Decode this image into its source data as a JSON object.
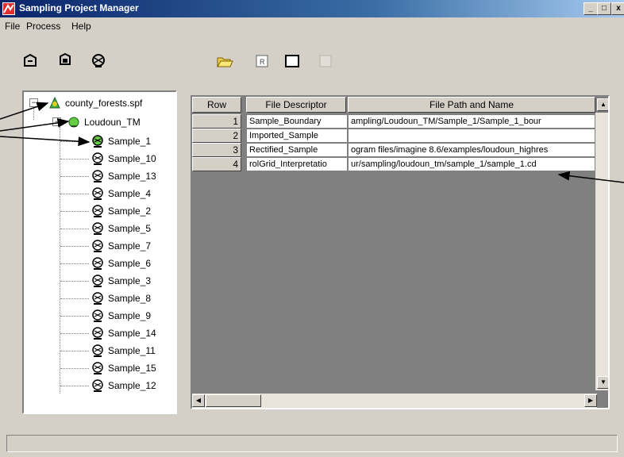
{
  "window": {
    "title": "Sampling Project Manager",
    "controls": {
      "minimize": "_",
      "maximize": "□",
      "close": "x"
    }
  },
  "menubar": {
    "items": [
      {
        "label": "File"
      },
      {
        "label": "Process"
      },
      {
        "label": "Help"
      }
    ]
  },
  "toolbar": {
    "left_tools": [
      "new-project-icon",
      "open-project-icon",
      "sample-tool-icon"
    ],
    "right_tools": [
      "open-folder-icon",
      "raster-icon",
      "window-icon",
      "disabled-window-icon"
    ]
  },
  "tree": {
    "root": "county_forests.spf",
    "project": "Loudoun_TM",
    "samples": [
      "Sample_1",
      "Sample_10",
      "Sample_13",
      "Sample_4",
      "Sample_2",
      "Sample_5",
      "Sample_7",
      "Sample_6",
      "Sample_3",
      "Sample_8",
      "Sample_9",
      "Sample_14",
      "Sample_11",
      "Sample_15",
      "Sample_12"
    ],
    "root_expander": "−",
    "project_expander": "−"
  },
  "grid": {
    "headers": {
      "row": "Row",
      "descriptor": "File Descriptor",
      "path": "File Path and Name"
    },
    "rows": [
      {
        "row": "1",
        "descriptor": "Sample_Boundary",
        "path": "ampling/Loudoun_TM/Sample_1/Sample_1_bour"
      },
      {
        "row": "2",
        "descriptor": "Imported_Sample",
        "path": ""
      },
      {
        "row": "3",
        "descriptor": "Rectified_Sample",
        "path": "ogram files/imagine 8.6/examples/loudoun_highres"
      },
      {
        "row": "4",
        "descriptor": "rolGrid_Interpretatio",
        "path": "ur/sampling/loudoun_tm/sample_1/sample_1.cd"
      }
    ]
  },
  "colors": {
    "titlebar_start": "#0a246a",
    "titlebar_end": "#a6caf0",
    "window_face": "#d4d0c8",
    "grid_background": "#808080"
  }
}
